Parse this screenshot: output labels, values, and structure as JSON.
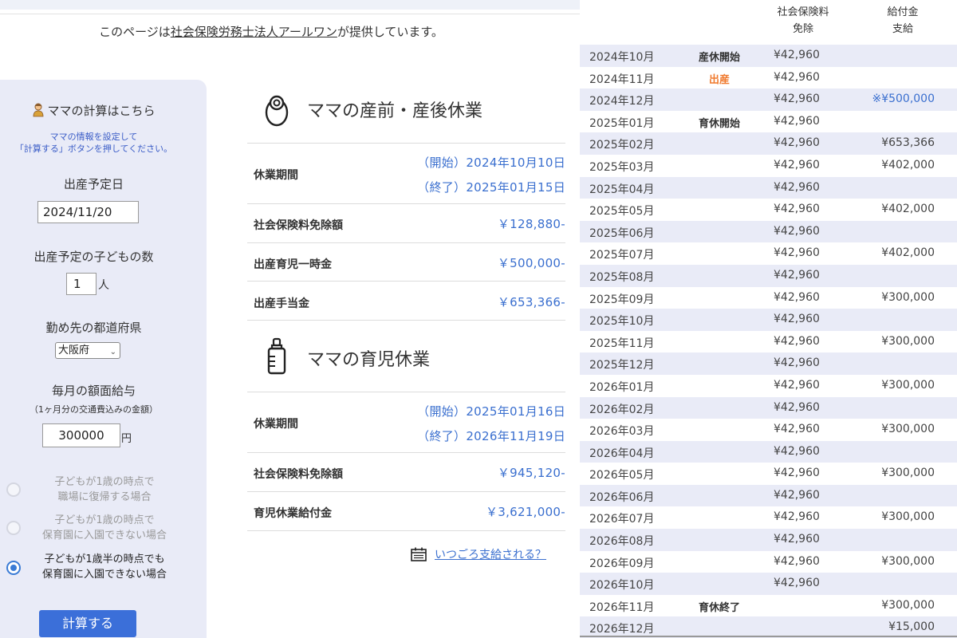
{
  "notice": {
    "prefix": "このページは",
    "link": "社会保険労務士法人アールワン",
    "suffix": "が提供しています。"
  },
  "form": {
    "title": "ママの計算はこちら",
    "hint_line1": "ママの情報を設定して",
    "hint_line2": "「計算する」ボタンを押してください。",
    "due_date_label": "出産予定日",
    "due_date_value": "2024/11/20",
    "child_count_label": "出産予定の子どもの数",
    "child_count_value": "1",
    "child_count_unit": "人",
    "prefecture_label": "勤め先の都道府県",
    "prefecture_value": "大阪府",
    "salary_label": "毎月の額面給与",
    "salary_note": "（1ヶ月分の交通費込みの金額）",
    "salary_value": "300000",
    "salary_unit": "円",
    "options": [
      {
        "line1": "子どもが1歳の時点で",
        "line2": "職場に復帰する場合",
        "selected": false
      },
      {
        "line1": "子どもが1歳の時点で",
        "line2": "保育園に入園できない場合",
        "selected": false
      },
      {
        "line1": "子どもが1歳半の時点でも",
        "line2": "保育園に入園できない場合",
        "selected": true
      }
    ],
    "calc_button": "計算する"
  },
  "maternity": {
    "title": "ママの産前・産後休業",
    "period_label": "休業期間",
    "period_start": "（開始）2024年10月10日",
    "period_end": "（終了）2025年01月15日",
    "insurance_label": "社会保険料免除額",
    "insurance_value": "￥128,880-",
    "lump_label": "出産育児一時金",
    "lump_value": "￥500,000-",
    "allowance_label": "出産手当金",
    "allowance_value": "￥653,366-"
  },
  "childcare": {
    "title": "ママの育児休業",
    "period_label": "休業期間",
    "period_start": "（開始）2025年01月16日",
    "period_end": "（終了）2026年11月19日",
    "insurance_label": "社会保険料免除額",
    "insurance_value": "￥945,120-",
    "benefit_label": "育児休業給付金",
    "benefit_value": "￥3,621,000-"
  },
  "when_link": "いつごろ支給される？",
  "schedule": {
    "header_insurance_l1": "社会保険料",
    "header_insurance_l2": "免除",
    "header_payment_l1": "給付金",
    "header_payment_l2": "支給",
    "rows": [
      {
        "month": "2024年10月",
        "event": "産休開始",
        "insurance": "¥42,960",
        "payment": ""
      },
      {
        "month": "2024年11月",
        "event": "出産",
        "insurance": "¥42,960",
        "payment": ""
      },
      {
        "month": "2024年12月",
        "event": "",
        "insurance": "¥42,960",
        "payment": "※¥500,000"
      },
      {
        "month": "2025年01月",
        "event": "育休開始",
        "insurance": "¥42,960",
        "payment": ""
      },
      {
        "month": "2025年02月",
        "event": "",
        "insurance": "¥42,960",
        "payment": "¥653,366"
      },
      {
        "month": "2025年03月",
        "event": "",
        "insurance": "¥42,960",
        "payment": "¥402,000"
      },
      {
        "month": "2025年04月",
        "event": "",
        "insurance": "¥42,960",
        "payment": ""
      },
      {
        "month": "2025年05月",
        "event": "",
        "insurance": "¥42,960",
        "payment": "¥402,000"
      },
      {
        "month": "2025年06月",
        "event": "",
        "insurance": "¥42,960",
        "payment": ""
      },
      {
        "month": "2025年07月",
        "event": "",
        "insurance": "¥42,960",
        "payment": "¥402,000"
      },
      {
        "month": "2025年08月",
        "event": "",
        "insurance": "¥42,960",
        "payment": ""
      },
      {
        "month": "2025年09月",
        "event": "",
        "insurance": "¥42,960",
        "payment": "¥300,000"
      },
      {
        "month": "2025年10月",
        "event": "",
        "insurance": "¥42,960",
        "payment": ""
      },
      {
        "month": "2025年11月",
        "event": "",
        "insurance": "¥42,960",
        "payment": "¥300,000"
      },
      {
        "month": "2025年12月",
        "event": "",
        "insurance": "¥42,960",
        "payment": ""
      },
      {
        "month": "2026年01月",
        "event": "",
        "insurance": "¥42,960",
        "payment": "¥300,000"
      },
      {
        "month": "2026年02月",
        "event": "",
        "insurance": "¥42,960",
        "payment": ""
      },
      {
        "month": "2026年03月",
        "event": "",
        "insurance": "¥42,960",
        "payment": "¥300,000"
      },
      {
        "month": "2026年04月",
        "event": "",
        "insurance": "¥42,960",
        "payment": ""
      },
      {
        "month": "2026年05月",
        "event": "",
        "insurance": "¥42,960",
        "payment": "¥300,000"
      },
      {
        "month": "2026年06月",
        "event": "",
        "insurance": "¥42,960",
        "payment": ""
      },
      {
        "month": "2026年07月",
        "event": "",
        "insurance": "¥42,960",
        "payment": "¥300,000"
      },
      {
        "month": "2026年08月",
        "event": "",
        "insurance": "¥42,960",
        "payment": ""
      },
      {
        "month": "2026年09月",
        "event": "",
        "insurance": "¥42,960",
        "payment": "¥300,000"
      },
      {
        "month": "2026年10月",
        "event": "",
        "insurance": "¥42,960",
        "payment": ""
      },
      {
        "month": "2026年11月",
        "event": "育休終了",
        "insurance": "",
        "payment": "¥300,000"
      },
      {
        "month": "2026年12月",
        "event": "",
        "insurance": "",
        "payment": "¥15,000"
      }
    ]
  },
  "colors": {
    "accent_blue": "#3a6fcf",
    "button_blue": "#3b6fd9",
    "panel_bg": "#e9ebf7",
    "birth_orange": "#f07a2e"
  }
}
